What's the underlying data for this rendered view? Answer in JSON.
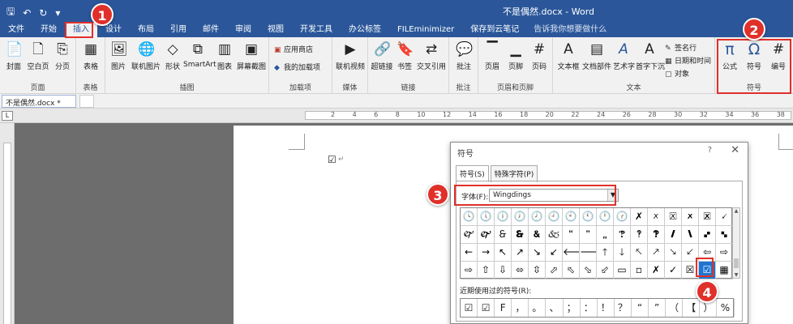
{
  "window": {
    "title": "不是偶然.docx - Word",
    "qat": [
      "🖫",
      "↶",
      "↻",
      "▾"
    ]
  },
  "tabs": [
    "文件",
    "开始",
    "插入",
    "设计",
    "布局",
    "引用",
    "邮件",
    "审阅",
    "视图",
    "开发工具",
    "办公标签",
    "FILEminimizer",
    "保存到云笔记"
  ],
  "tell_me": "告诉我你想要做什么",
  "ribbon": {
    "groups": [
      {
        "label": "页面",
        "buttons": [
          {
            "label": "封面",
            "icon": "📄"
          },
          {
            "label": "空白页",
            "icon": "🗋"
          },
          {
            "label": "分页",
            "icon": "⎘"
          }
        ]
      },
      {
        "label": "表格",
        "buttons": [
          {
            "label": "表格",
            "icon": "▦"
          }
        ]
      },
      {
        "label": "插图",
        "buttons": [
          {
            "label": "图片",
            "icon": "🖼"
          },
          {
            "label": "联机图片",
            "icon": "🌐"
          },
          {
            "label": "形状",
            "icon": "◇"
          },
          {
            "label": "SmartArt",
            "icon": "⧉"
          },
          {
            "label": "图表",
            "icon": "▥"
          },
          {
            "label": "屏幕截图",
            "icon": "▣"
          }
        ]
      },
      {
        "label": "加载项",
        "small": [
          "应用商店",
          "我的加载项"
        ]
      },
      {
        "label": "媒体",
        "buttons": [
          {
            "label": "联机视频",
            "icon": "▶"
          }
        ]
      },
      {
        "label": "链接",
        "buttons": [
          {
            "label": "超链接",
            "icon": "🔗"
          },
          {
            "label": "书签",
            "icon": "🔖"
          },
          {
            "label": "交叉引用",
            "icon": "⇄"
          }
        ]
      },
      {
        "label": "批注",
        "buttons": [
          {
            "label": "批注",
            "icon": "💬"
          }
        ]
      },
      {
        "label": "页眉和页脚",
        "buttons": [
          {
            "label": "页眉",
            "icon": "▔"
          },
          {
            "label": "页脚",
            "icon": "▁"
          },
          {
            "label": "页码",
            "icon": "#"
          }
        ]
      },
      {
        "label": "文本",
        "buttons": [
          {
            "label": "文本框",
            "icon": "A"
          },
          {
            "label": "文档部件",
            "icon": "▤"
          },
          {
            "label": "艺术字",
            "icon": "A"
          },
          {
            "label": "首字下沉",
            "icon": "A"
          }
        ],
        "small": [
          "签名行",
          "日期和时间",
          "对象"
        ]
      },
      {
        "label": "符号",
        "buttons": [
          {
            "label": "公式",
            "icon": "π"
          },
          {
            "label": "符号",
            "icon": "Ω"
          },
          {
            "label": "编号",
            "icon": "#"
          }
        ]
      }
    ]
  },
  "doc_tab": "不是偶然.docx *",
  "ruler_numbers": [
    "2",
    "4",
    "6",
    "8",
    "10",
    "12",
    "14",
    "16",
    "18",
    "20",
    "22",
    "24",
    "26",
    "28",
    "30",
    "32",
    "34",
    "36",
    "38"
  ],
  "document": {
    "inserted_symbol": "☑",
    "para_mark": "↵"
  },
  "dialog": {
    "title": "符号",
    "help": "?",
    "close": "✕",
    "tabs": [
      "符号(S)",
      "特殊字符(P)"
    ],
    "font_label": "字体(F):",
    "font_value": "Wingdings",
    "symbols": [
      "🕓",
      "🕔",
      "🕕",
      "🕖",
      "🕗",
      "🕘",
      "🕙",
      "🕚",
      "🕛",
      "🕜",
      "✗",
      "🗴",
      "🗵",
      "🗶",
      "🗷",
      "🗸",
      "🙰",
      "🙱",
      "🙲",
      "🙳",
      "🙴",
      "🙵",
      "🙶",
      "🙷",
      "🙸",
      "🙹",
      "🙺",
      "🙻",
      "🙼",
      "🙽",
      "🙾",
      "🙿",
      "←",
      "→",
      "↖",
      "↗",
      "↘",
      "↙",
      "🡐",
      "🡒",
      "🡑",
      "🡓",
      "🡔",
      "🡕",
      "🡖",
      "🡗",
      "⇦",
      "⇨",
      "⇨",
      "⇧",
      "⇩",
      "⬄",
      "⇳",
      "⬀",
      "⬁",
      "⬂",
      "⬃",
      "▭",
      "▫",
      "✗",
      "✓",
      "☒",
      "☑",
      "▦"
    ],
    "selected_index": 62,
    "recent_label": "近期使用过的符号(R):",
    "recent": [
      "☑",
      "☑",
      "F",
      "，",
      "。",
      "、",
      "；",
      "：",
      "！",
      "？",
      "“",
      "”",
      "（",
      "【",
      "）",
      "%"
    ]
  },
  "markers": [
    "1",
    "2",
    "3",
    "4"
  ],
  "colors": {
    "accent": "#2b579a",
    "marker": "#e0302a",
    "selected": "#1f75d1"
  }
}
